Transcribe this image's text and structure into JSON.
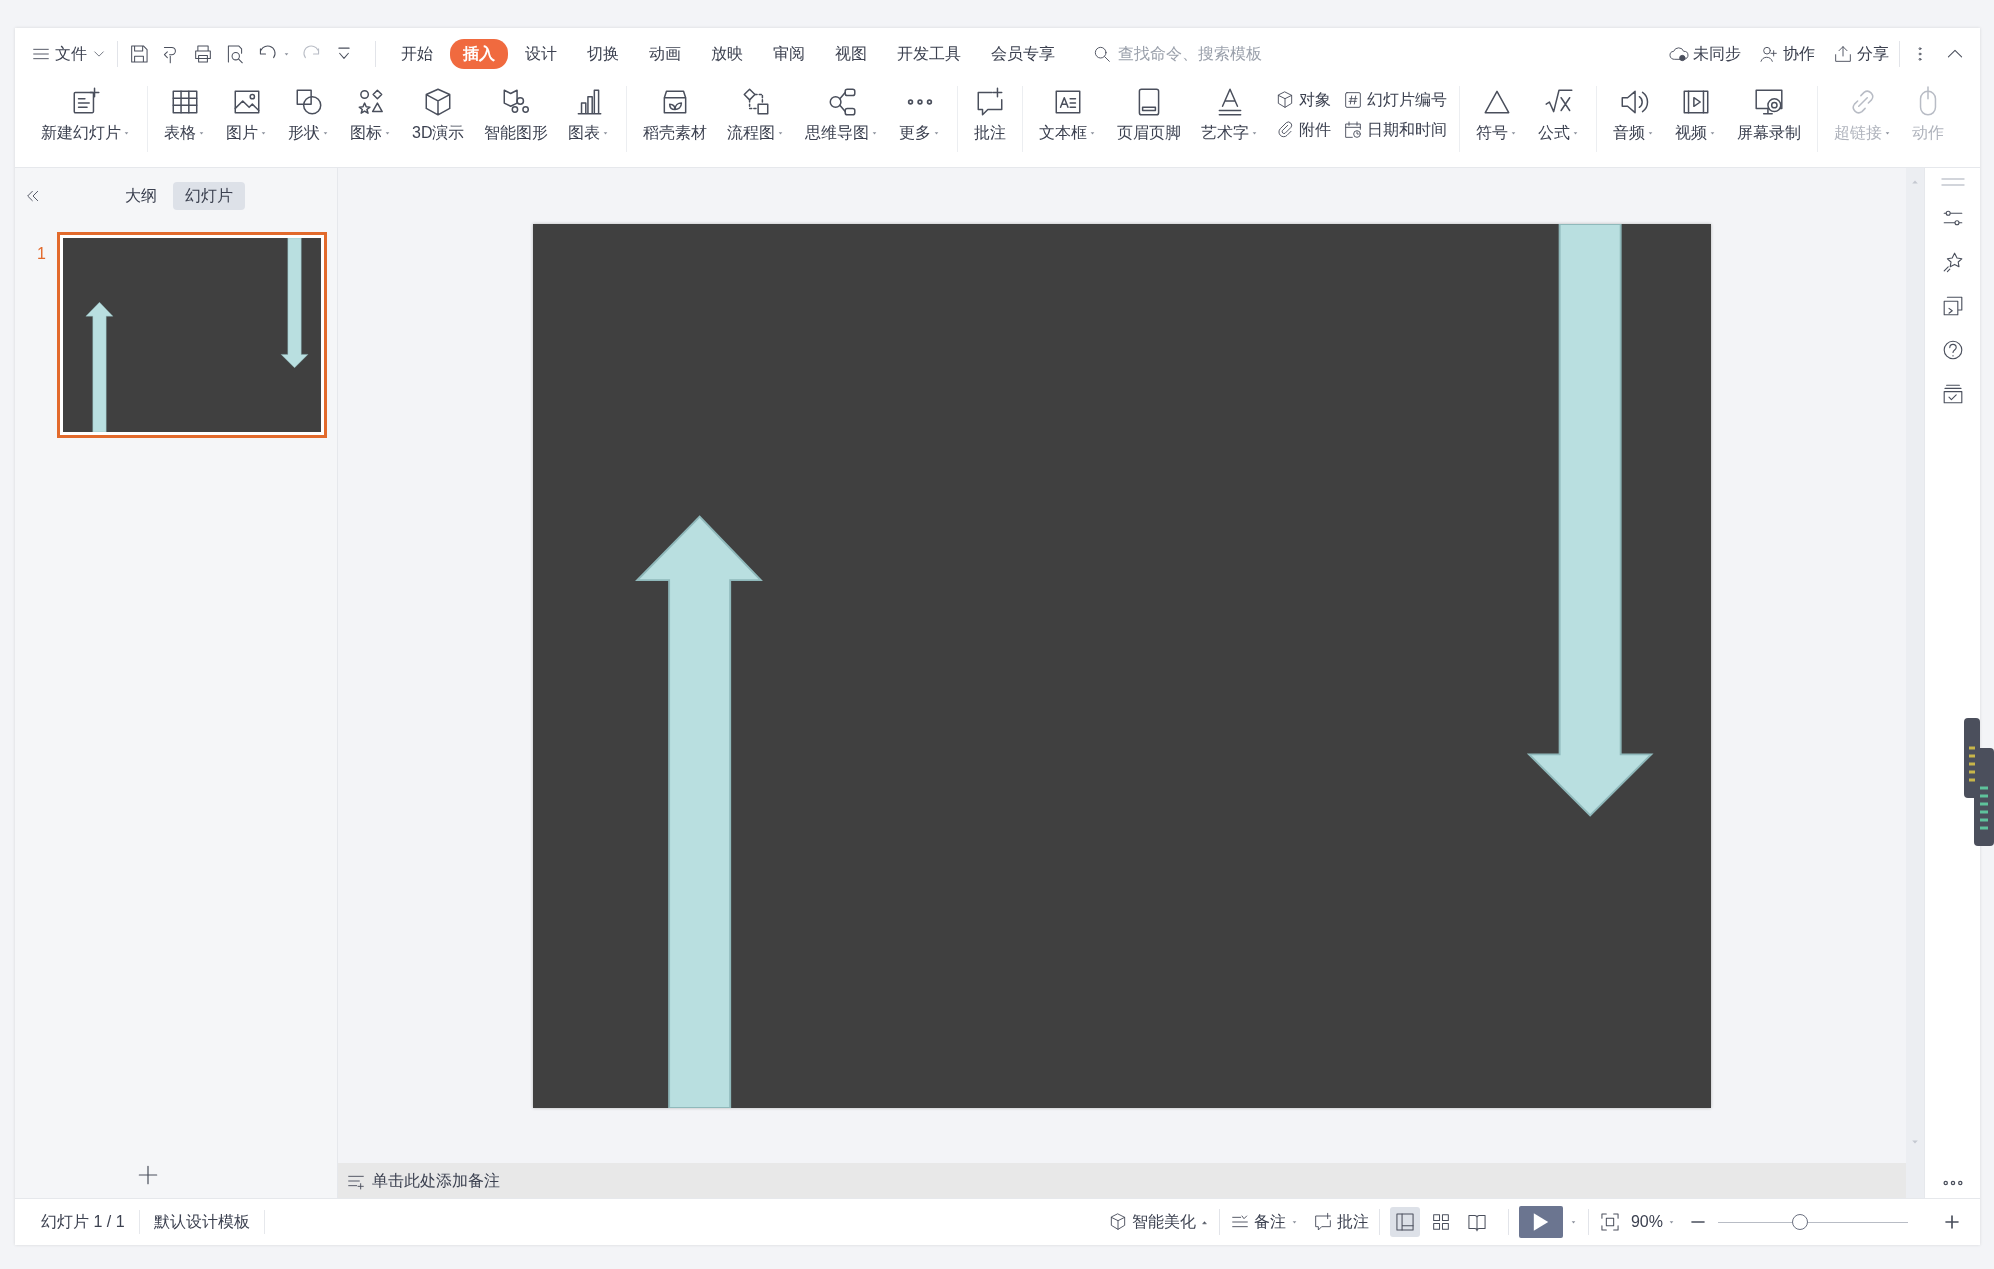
{
  "menu": {
    "file": "文件",
    "quick_access": [
      {
        "dropdown": false,
        "disabled": false
      },
      {
        "dropdown": false,
        "disabled": false
      },
      {
        "dropdown": false,
        "disabled": false
      },
      {
        "dropdown": false,
        "disabled": false
      },
      {
        "dropdown": true,
        "disabled": false
      },
      {
        "dropdown": false,
        "disabled": true
      },
      {
        "dropdown": false,
        "disabled": false
      }
    ],
    "tabs": [
      {
        "label": "开始",
        "selected": false
      },
      {
        "label": "插入",
        "selected": true
      },
      {
        "label": "设计",
        "selected": false
      },
      {
        "label": "切换",
        "selected": false
      },
      {
        "label": "动画",
        "selected": false
      },
      {
        "label": "放映",
        "selected": false
      },
      {
        "label": "审阅",
        "selected": false
      },
      {
        "label": "视图",
        "selected": false
      },
      {
        "label": "开发工具",
        "selected": false
      },
      {
        "label": "会员专享",
        "selected": false
      }
    ],
    "search": {
      "placeholder": "查找命令、搜索模板"
    },
    "actions": [
      {
        "label": "未同步"
      },
      {
        "label": "协作"
      },
      {
        "label": "分享"
      }
    ]
  },
  "ribbon": {
    "groups": [
      {
        "items": [
          {
            "kind": "large",
            "label": "新建幻灯片",
            "dropdown": true,
            "disabled": false
          }
        ]
      },
      {
        "items": [
          {
            "kind": "large",
            "label": "表格",
            "dropdown": true,
            "disabled": false
          },
          {
            "kind": "large",
            "label": "图片",
            "dropdown": true,
            "disabled": false
          },
          {
            "kind": "large",
            "label": "形状",
            "dropdown": true,
            "disabled": false
          },
          {
            "kind": "large",
            "label": "图标",
            "dropdown": true,
            "disabled": false
          },
          {
            "kind": "large",
            "label": "3D演示",
            "dropdown": false,
            "disabled": false
          },
          {
            "kind": "large",
            "label": "智能图形",
            "dropdown": false,
            "disabled": false
          },
          {
            "kind": "large",
            "label": "图表",
            "dropdown": true,
            "disabled": false
          }
        ]
      },
      {
        "items": [
          {
            "kind": "large",
            "label": "稻壳素材",
            "dropdown": false,
            "disabled": false
          },
          {
            "kind": "large",
            "label": "流程图",
            "dropdown": true,
            "disabled": false
          },
          {
            "kind": "large",
            "label": "思维导图",
            "dropdown": true,
            "disabled": false
          },
          {
            "kind": "large",
            "label": "更多",
            "dropdown": true,
            "disabled": false
          }
        ]
      },
      {
        "items": [
          {
            "kind": "large",
            "label": "批注",
            "dropdown": false,
            "disabled": false
          }
        ]
      },
      {
        "items": [
          {
            "kind": "large",
            "label": "文本框",
            "dropdown": true,
            "disabled": false
          },
          {
            "kind": "large",
            "label": "页眉页脚",
            "dropdown": false,
            "disabled": false
          },
          {
            "kind": "large",
            "label": "艺术字",
            "dropdown": true,
            "disabled": false
          },
          {
            "kind": "stack",
            "items": [
              {
                "label": "对象"
              },
              {
                "label": "附件"
              }
            ]
          },
          {
            "kind": "stack",
            "items": [
              {
                "label": "幻灯片编号"
              },
              {
                "label": "日期和时间"
              }
            ]
          }
        ]
      },
      {
        "items": [
          {
            "kind": "large",
            "label": "符号",
            "dropdown": true,
            "disabled": false
          },
          {
            "kind": "large",
            "label": "公式",
            "dropdown": true,
            "disabled": false
          }
        ]
      },
      {
        "items": [
          {
            "kind": "large",
            "label": "音频",
            "dropdown": true,
            "disabled": false
          },
          {
            "kind": "large",
            "label": "视频",
            "dropdown": true,
            "disabled": false
          },
          {
            "kind": "large",
            "label": "屏幕录制",
            "dropdown": false,
            "disabled": false
          }
        ]
      },
      {
        "items": [
          {
            "kind": "large",
            "label": "超链接",
            "dropdown": true,
            "disabled": true
          },
          {
            "kind": "large",
            "label": "动作",
            "dropdown": false,
            "disabled": true
          }
        ]
      }
    ]
  },
  "sidebar": {
    "tabs": [
      {
        "label": "大纲",
        "selected": false
      },
      {
        "label": "幻灯片",
        "selected": true
      }
    ],
    "slides": [
      {
        "number": "1",
        "selected": true
      }
    ]
  },
  "notes": {
    "prompt": "单击此处添加备注"
  },
  "status_bar": {
    "slide_info": "幻灯片 1 / 1",
    "template": "默认设计模板",
    "beautify": "智能美化",
    "notes": "备注",
    "comments": "批注",
    "views": [
      {
        "selected": true
      },
      {
        "selected": false
      },
      {
        "selected": false
      }
    ],
    "zoom": {
      "value": "90%",
      "level": 0.43
    }
  }
}
